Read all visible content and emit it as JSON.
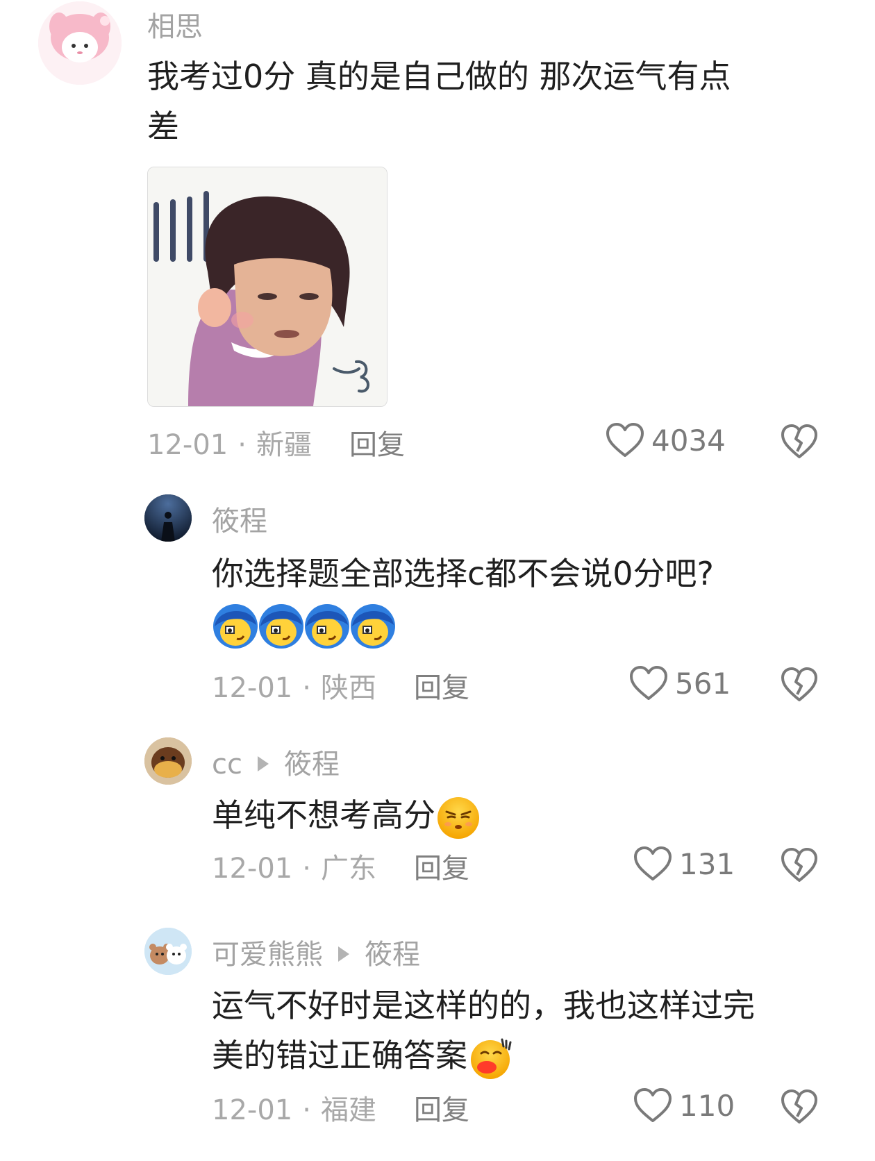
{
  "comments": [
    {
      "user": "相思",
      "text_lines": [
        "我考过0分 真的是自己做的 那次运气有点",
        "差"
      ],
      "date": "12-01",
      "location": "新疆",
      "reply_label": "回复",
      "likes": "4034"
    },
    {
      "user": "筱程",
      "text": "你选择题全部选择c都不会说0分吧?",
      "date": "12-01",
      "location": "陕西",
      "reply_label": "回复",
      "likes": "561"
    },
    {
      "user": "cc",
      "reply_to": "筱程",
      "text": "单纯不想考高分",
      "date": "12-01",
      "location": "广东",
      "reply_label": "回复",
      "likes": "131"
    },
    {
      "user": "可爱熊熊",
      "reply_to": "筱程",
      "text_lines": [
        "运气不好时是这样的的，我也这样过完",
        "美的错过正确答案"
      ],
      "date": "12-01",
      "location": "福建",
      "reply_label": "回复",
      "likes": "110"
    }
  ],
  "icons": {
    "like": "heart-outline-icon",
    "dislike": "broken-heart-icon"
  },
  "colors": {
    "username": "#a3a3a3",
    "text": "#1f1f1f",
    "meta": "#a8a8a8",
    "icon": "#7a7a7a"
  }
}
